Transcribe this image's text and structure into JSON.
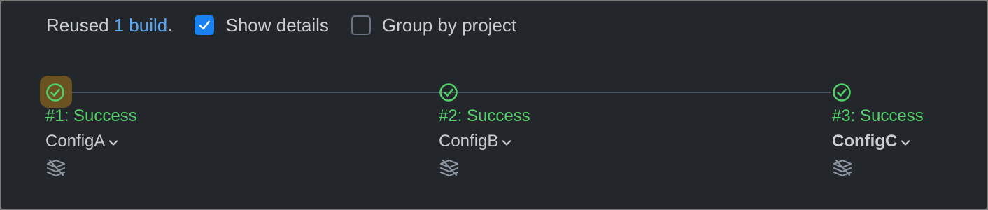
{
  "toolbar": {
    "reused_prefix": "Reused",
    "reused_link": "1 build",
    "reused_suffix": ".",
    "show_details": {
      "label": "Show details",
      "checked": true
    },
    "group_by_project": {
      "label": "Group by project",
      "checked": false
    }
  },
  "stages": [
    {
      "title": "#1: Success",
      "config": "ConfigA",
      "status": "success",
      "highlighted": true,
      "bold": false
    },
    {
      "title": "#2: Success",
      "config": "ConfigB",
      "status": "success",
      "highlighted": false,
      "bold": false
    },
    {
      "title": "#3: Success",
      "config": "ConfigC",
      "status": "success",
      "highlighted": false,
      "bold": true
    }
  ],
  "icons": {
    "status": "check-circle-icon",
    "dropdown": "chevron-down-icon",
    "artifact": "layers-icon",
    "checkbox": "checkmark-icon"
  },
  "colors": {
    "background": "#23272c",
    "success": "#53d06a",
    "link": "#5aa5f0",
    "checkbox_on": "#1a82f0",
    "highlight": "#6b5321"
  }
}
